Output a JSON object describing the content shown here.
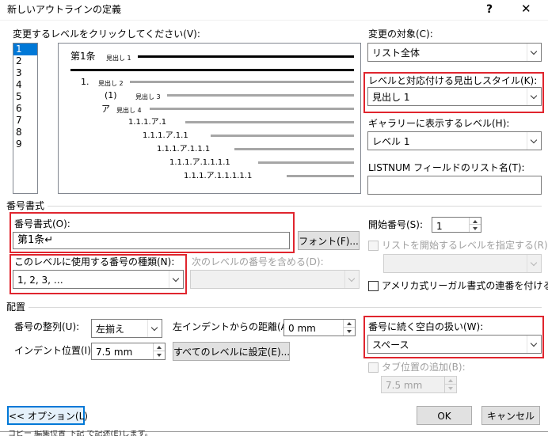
{
  "dialog": {
    "title": "新しいアウトラインの定義",
    "help_glyph": "?",
    "close_glyph": "✕"
  },
  "levels": {
    "label": "変更するレベルをクリックしてください(V):",
    "items": [
      "1",
      "2",
      "3",
      "4",
      "5",
      "6",
      "7",
      "8",
      "9"
    ],
    "selected": "1"
  },
  "preview": {
    "row1_num": "第1条",
    "row1_text": "見出し 1",
    "row2_num": "1.",
    "row2_text": "見出し 2",
    "row3_num": "(1)",
    "row3_text": "見出し 3",
    "row4_num": "ア",
    "row4_text": "見出し 4",
    "row5": "1.1.1.ア.1",
    "row6": "1.1.1.ア.1.1",
    "row7": "1.1.1.ア.1.1.1",
    "row8": "1.1.1.ア.1.1.1.1",
    "row9": "1.1.1.ア.1.1.1.1.1"
  },
  "apply_to": {
    "label": "変更の対象(C):",
    "value": "リスト全体"
  },
  "link_style": {
    "label": "レベルと対応付ける見出しスタイル(K):",
    "value": "見出し 1"
  },
  "gallery_level": {
    "label": "ギャラリーに表示するレベル(H):",
    "value": "レベル 1"
  },
  "listnum": {
    "label": "LISTNUM フィールドのリスト名(T):",
    "value": ""
  },
  "number_format_section": "番号書式",
  "number_format": {
    "label": "番号書式(O):",
    "value": "第1条↵"
  },
  "font_button": "フォント(F)...",
  "number_style": {
    "label": "このレベルに使用する番号の種類(N):",
    "value": "1, 2, 3, …"
  },
  "include_level": {
    "label": "次のレベルの番号を含める(D):",
    "value": ""
  },
  "start_at": {
    "label": "開始番号(S):",
    "value": "1"
  },
  "restart": {
    "label": "リストを開始するレベルを指定する(R):",
    "value": ""
  },
  "legal": {
    "label": "アメリカ式リーガル書式の連番を付ける(G)"
  },
  "position_section": "配置",
  "alignment": {
    "label": "番号の整列(U):",
    "value": "左揃え"
  },
  "aligned_at": {
    "label": "左インデントからの距離(A):",
    "value": "0 mm"
  },
  "indent_at": {
    "label": "インデント位置(I):",
    "value": "7.5 mm"
  },
  "set_all_button": "すべてのレベルに設定(E)...",
  "follow_with": {
    "label": "番号に続く空白の扱い(W):",
    "value": "スペース"
  },
  "tab_stop": {
    "label": "タブ位置の追加(B):",
    "value": "7.5 mm"
  },
  "buttons": {
    "options": "<< オプション(L)",
    "ok": "OK",
    "cancel": "キャンセル"
  },
  "status_bar_fragment": "コピー 編集位置 下記 で記述(E)します。",
  "highlight_color": "#e0252e",
  "selection_color": "#0078d7"
}
